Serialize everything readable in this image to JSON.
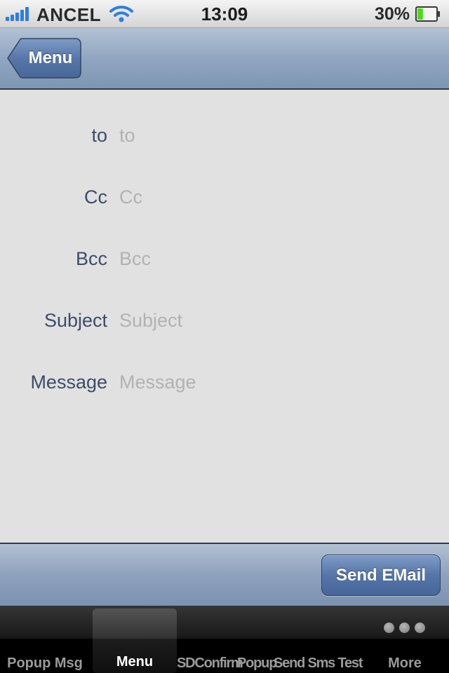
{
  "status_bar": {
    "carrier": "ANCEL",
    "time": "13:09",
    "battery_percent": "30%",
    "signal_icon": "signal-bars-icon",
    "wifi_icon": "wifi-icon",
    "battery_icon": "battery-icon",
    "battery_level": 0.3
  },
  "nav_bar": {
    "back_label": "Menu"
  },
  "form": {
    "fields": [
      {
        "label": "to",
        "placeholder": "to"
      },
      {
        "label": "Cc",
        "placeholder": "Cc"
      },
      {
        "label": "Bcc",
        "placeholder": "Bcc"
      },
      {
        "label": "Subject",
        "placeholder": "Subject"
      },
      {
        "label": "Message",
        "placeholder": "Message"
      }
    ]
  },
  "toolbar": {
    "send_label": "Send EMail"
  },
  "tab_bar": {
    "tabs": [
      {
        "label": "Popup Msg",
        "selected": false
      },
      {
        "label": "Menu",
        "selected": true
      },
      {
        "label": "SDConfirm",
        "selected": false
      },
      {
        "label": "Popup",
        "selected": false
      },
      {
        "label": "Send Sms Test",
        "selected": false
      },
      {
        "label": "More",
        "selected": false
      }
    ],
    "more_icon": "more-dots-icon"
  },
  "colors": {
    "nav_bar": "#91a6c0",
    "label_text": "#3e4c6a",
    "placeholder_text": "#b2b2b2",
    "send_button": "#5675a8",
    "battery_fill": "#4cd91c"
  }
}
